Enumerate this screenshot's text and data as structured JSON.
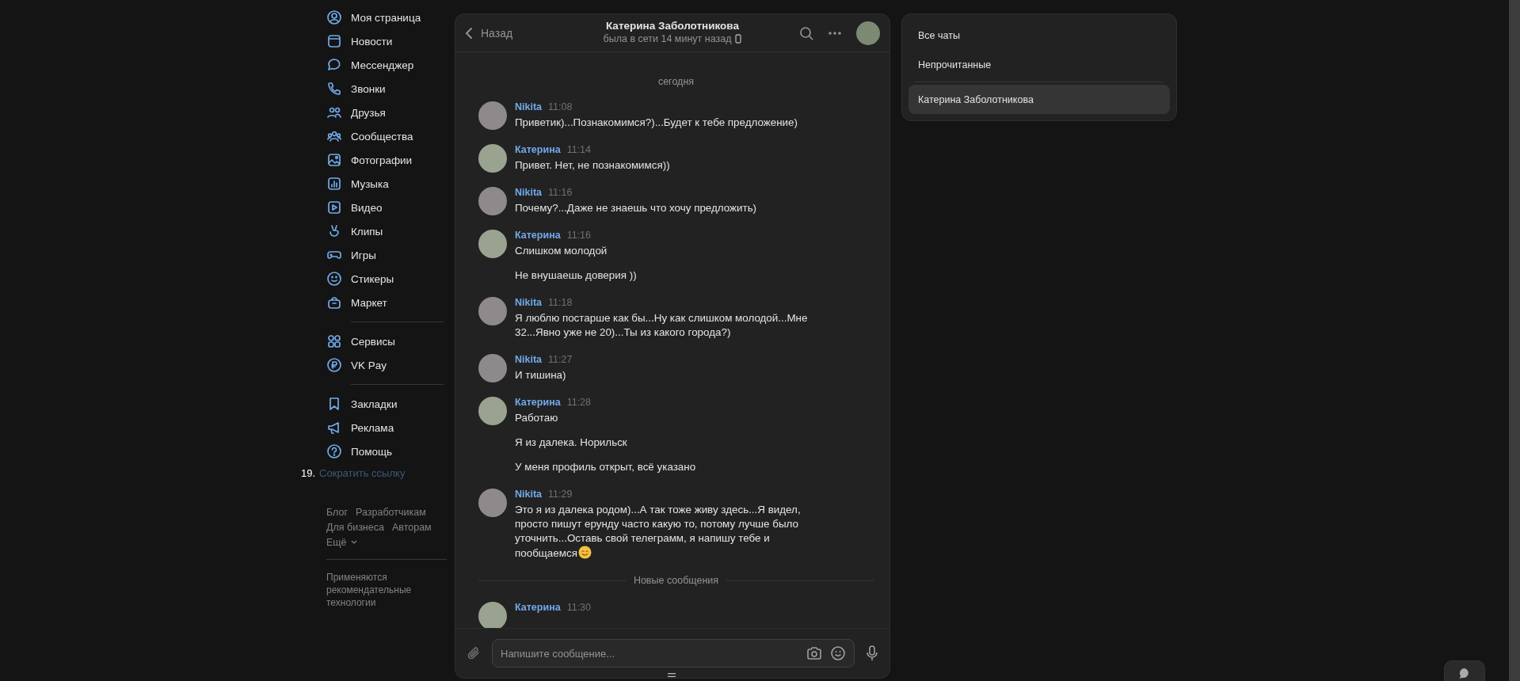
{
  "sidebar": {
    "groups": [
      {
        "items": [
          {
            "label": "Моя страница"
          },
          {
            "label": "Новости"
          },
          {
            "label": "Мессенджер"
          },
          {
            "label": "Звонки"
          },
          {
            "label": "Друзья"
          },
          {
            "label": "Сообщества"
          },
          {
            "label": "Фотографии"
          },
          {
            "label": "Музыка"
          },
          {
            "label": "Видео"
          },
          {
            "label": "Клипы"
          },
          {
            "label": "Игры"
          },
          {
            "label": "Стикеры"
          },
          {
            "label": "Маркет"
          }
        ]
      },
      {
        "items": [
          {
            "label": "Сервисы"
          },
          {
            "label": "VK Pay"
          }
        ]
      },
      {
        "items": [
          {
            "label": "Закладки"
          },
          {
            "label": "Реклама"
          },
          {
            "label": "Помощь"
          }
        ]
      }
    ],
    "numbered_link": {
      "number": "19.",
      "label": "Сократить ссылку"
    },
    "footer": {
      "rows": [
        [
          "Блог",
          "Разработчикам"
        ],
        [
          "Для бизнеса",
          "Авторам"
        ]
      ],
      "more": "Ещё",
      "note": "Применяются рекомендательные технологии"
    }
  },
  "chat": {
    "header": {
      "back": "Назад",
      "title": "Катерина Заболотникова",
      "status": "была в сети 14 минут назад"
    },
    "items": [
      {
        "kind": "date",
        "text": "сегодня"
      },
      {
        "kind": "message",
        "author": "Nikita",
        "time": "11:08",
        "paragraphs": [
          "Приветик)...Познакомимся?)...Будет к тебе предложение)"
        ]
      },
      {
        "kind": "message",
        "author": "Катерина",
        "time": "11:14",
        "paragraphs": [
          "Привет. Нет, не познакомимся))"
        ]
      },
      {
        "kind": "message",
        "author": "Nikita",
        "time": "11:16",
        "paragraphs": [
          "Почему?...Даже не знаешь что хочу предложить)"
        ]
      },
      {
        "kind": "message",
        "author": "Катерина",
        "time": "11:16",
        "paragraphs": [
          "Слишком молодой",
          "Не внушаешь доверия ))"
        ]
      },
      {
        "kind": "message",
        "author": "Nikita",
        "time": "11:18",
        "paragraphs": [
          "Я люблю постарше как бы...Ну как слишком молодой...Мне 32...Явно уже не 20)...Ты из какого города?)"
        ]
      },
      {
        "kind": "message",
        "author": "Nikita",
        "time": "11:27",
        "paragraphs": [
          "И тишина)"
        ]
      },
      {
        "kind": "message",
        "author": "Катерина",
        "time": "11:28",
        "paragraphs": [
          "Работаю",
          "Я из далека. Норильск",
          "У меня профиль открыт, всё указано"
        ]
      },
      {
        "kind": "message_emoji",
        "author": "Nikita",
        "time": "11:29",
        "paragraphs": [
          "Это я из далека родом)...А так тоже живу здесь...Я видел, просто пишут ерунду часто какую то, потому лучше было уточнить...Оставь свой телеграмм, я напишу тебе и пообщаемся"
        ]
      },
      {
        "kind": "divider",
        "text": "Новые сообщения"
      },
      {
        "kind": "message",
        "author": "Катерина",
        "time": "11:30"
      }
    ],
    "composer": {
      "placeholder": "Напишите сообщение..."
    }
  },
  "filters": {
    "items": [
      {
        "label": "Все чаты",
        "selected": false
      },
      {
        "label": "Непрочитанные",
        "selected": false
      },
      {
        "label": "Катерина Заболотникова",
        "selected": true
      }
    ]
  }
}
